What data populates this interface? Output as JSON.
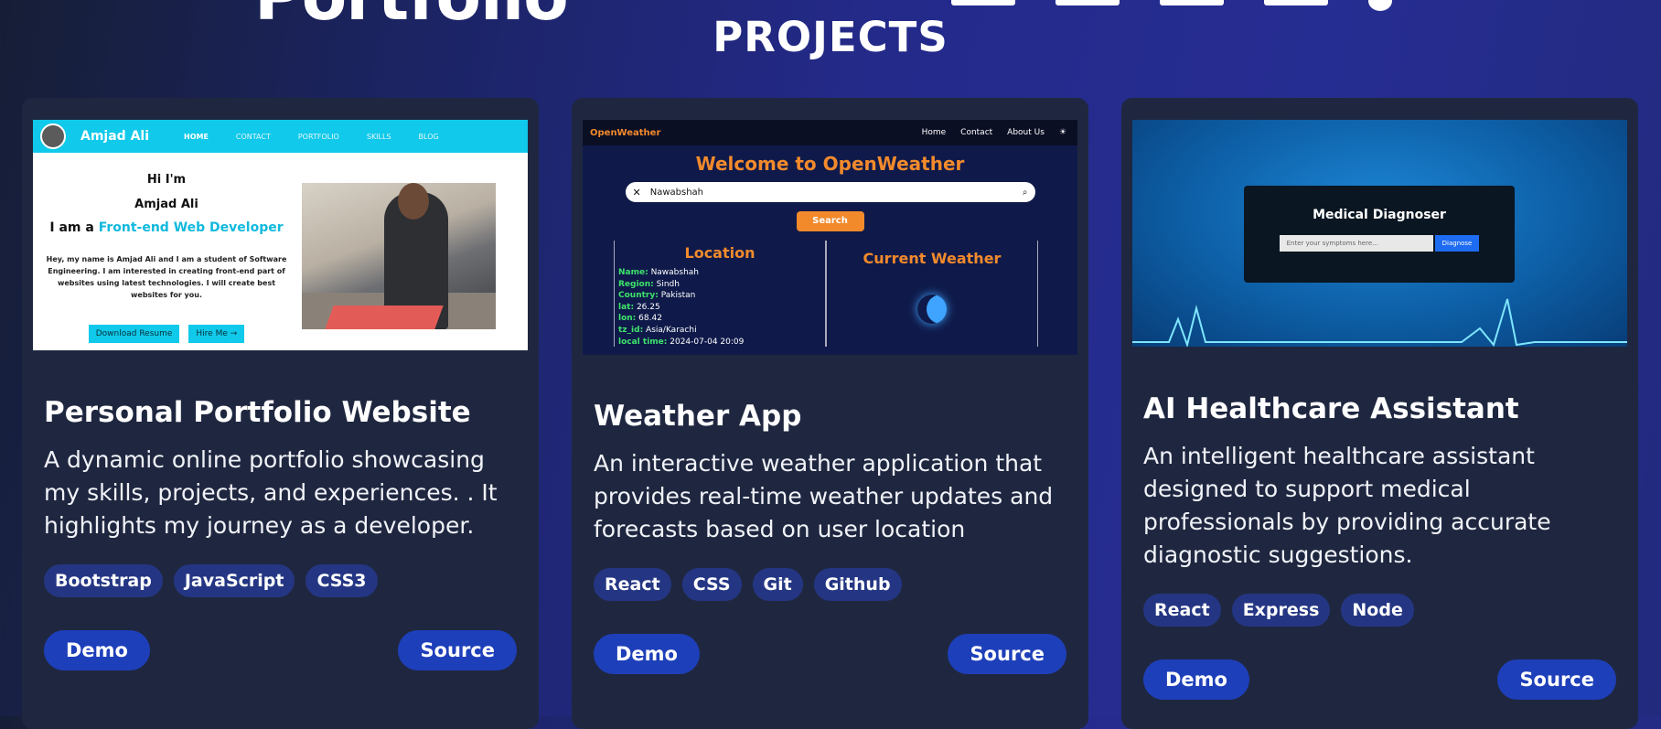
{
  "header": {
    "logo_text": "Portfolio",
    "section_title": "PROJECTS"
  },
  "projects": [
    {
      "title": "Personal Portfolio Website",
      "description": "A dynamic online portfolio showcasing my skills, projects, and experiences. . It highlights my journey as a developer.",
      "tags": [
        "Bootstrap",
        "JavaScript",
        "CSS3"
      ],
      "demo_label": "Demo",
      "source_label": "Source",
      "preview": {
        "brand": "Amjad Ali",
        "nav": [
          "HOME",
          "CONTACT",
          "PORTFOLIO",
          "SKILLS",
          "BLOG"
        ],
        "hi": "Hi I'm",
        "name": "Amjad Ali",
        "role_prefix": "I am a",
        "role": "Front-end Web Developer",
        "bio": "Hey, my name is Amjad Ali and I am a student of Software Engineering. I am interested in creating front-end part of websites using latest technologies. I will create best websites for you.",
        "btn_resume": "Download Resume",
        "btn_hire": "Hire Me →"
      }
    },
    {
      "title": "Weather App",
      "description": "An interactive weather application that provides real-time weather updates and forecasts based on user location",
      "tags": [
        "React",
        "CSS",
        "Git",
        "Github"
      ],
      "demo_label": "Demo",
      "source_label": "Source",
      "preview": {
        "logo": "OpenWeather",
        "nav": [
          "Home",
          "Contact",
          "About Us"
        ],
        "welcome": "Welcome to OpenWeather",
        "search_value": "Nawabshah",
        "search_btn": "Search",
        "location_title": "Location",
        "weather_title": "Current Weather",
        "rows": [
          {
            "k": "Name:",
            "v": "Nawabshah"
          },
          {
            "k": "Region:",
            "v": "Sindh"
          },
          {
            "k": "Country:",
            "v": "Pakistan"
          },
          {
            "k": "lat:",
            "v": "26.25"
          },
          {
            "k": "lon:",
            "v": "68.42"
          },
          {
            "k": "tz_id:",
            "v": "Asia/Karachi"
          },
          {
            "k": "local time:",
            "v": "2024-07-04 20:09"
          }
        ]
      }
    },
    {
      "title": "AI Healthcare Assistant",
      "description": "An intelligent healthcare assistant designed to support medical professionals by providing accurate diagnostic suggestions.",
      "tags": [
        "React",
        "Express",
        "Node"
      ],
      "demo_label": "Demo",
      "source_label": "Source",
      "preview": {
        "title": "Medical Diagnoser",
        "placeholder": "Enter your symptoms here...",
        "button": "Diagnose"
      }
    }
  ],
  "colors": {
    "card_bg": "#1f2740",
    "button": "#1e3fba",
    "tag": "#243683",
    "accent_cyan": "#11c9ea",
    "accent_orange": "#f28a2c"
  }
}
